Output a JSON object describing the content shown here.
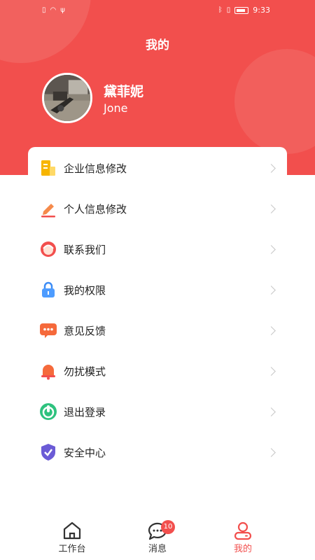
{
  "status_bar": {
    "time": "9:33"
  },
  "header": {
    "title": "我的",
    "user_name": "黛菲妮",
    "user_english_name": "Jone"
  },
  "menu": {
    "items": [
      {
        "label": "企业信息修改",
        "icon": "building-icon"
      },
      {
        "label": "个人信息修改",
        "icon": "pencil-icon"
      },
      {
        "label": "联系我们",
        "icon": "customer-service-icon"
      },
      {
        "label": "我的权限",
        "icon": "lock-icon"
      },
      {
        "label": "意见反馈",
        "icon": "chat-bubble-icon"
      },
      {
        "label": "勿扰模式",
        "icon": "bell-icon"
      },
      {
        "label": "退出登录",
        "icon": "power-icon"
      },
      {
        "label": "安全中心",
        "icon": "shield-check-icon"
      }
    ]
  },
  "bottom_nav": {
    "tabs": [
      {
        "label": "工作台",
        "icon": "home-icon",
        "active": false
      },
      {
        "label": "消息",
        "icon": "message-icon",
        "badge": "10",
        "active": false
      },
      {
        "label": "我的",
        "icon": "user-icon",
        "active": true
      }
    ]
  },
  "colors": {
    "accent": "#f24f4d"
  }
}
